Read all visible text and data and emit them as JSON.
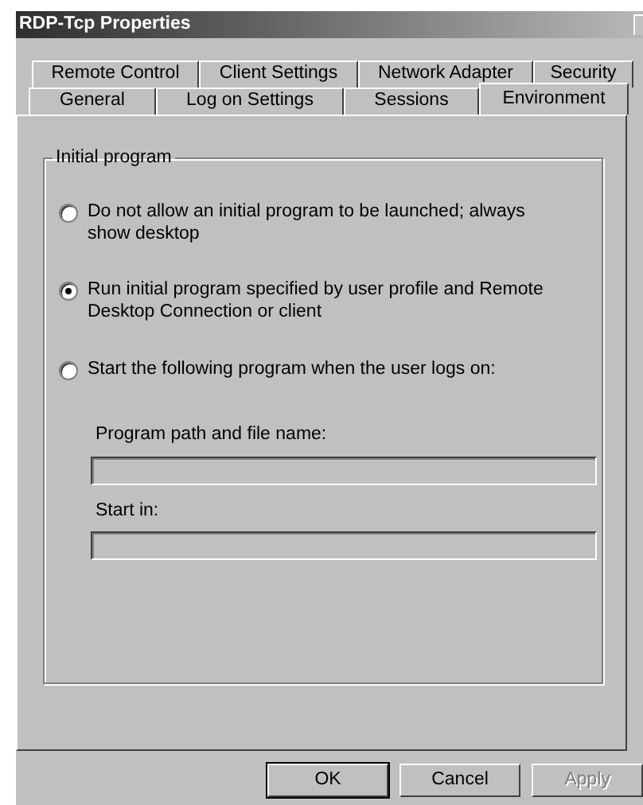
{
  "window": {
    "title": "RDP-Tcp Properties"
  },
  "tab_rows": [
    {
      "tabs": [
        {
          "label": "Remote Control",
          "selected": false
        },
        {
          "label": "Client Settings",
          "selected": false
        },
        {
          "label": "Network Adapter",
          "selected": false
        },
        {
          "label": "Security",
          "selected": false
        }
      ]
    },
    {
      "tabs": [
        {
          "label": "General",
          "selected": false
        },
        {
          "label": "Log on Settings",
          "selected": false
        },
        {
          "label": "Sessions",
          "selected": false
        },
        {
          "label": "Environment",
          "selected": true
        }
      ]
    }
  ],
  "group": {
    "title": "Initial program",
    "options": [
      {
        "label": "Do not allow an initial program to be launched; always show desktop",
        "selected": false
      },
      {
        "label": "Run initial program specified by user profile and Remote Desktop Connection or client",
        "selected": true
      },
      {
        "label": "Start the following program when the user logs on:",
        "selected": false
      }
    ],
    "fields": [
      {
        "label": "Program path and file name:",
        "disabled": true
      },
      {
        "label": "Start in:",
        "disabled": true
      }
    ]
  },
  "buttons": [
    {
      "label": "OK",
      "default": true,
      "disabled": false
    },
    {
      "label": "Cancel",
      "default": false,
      "disabled": false
    },
    {
      "label": "Apply",
      "default": false,
      "disabled": true
    }
  ]
}
